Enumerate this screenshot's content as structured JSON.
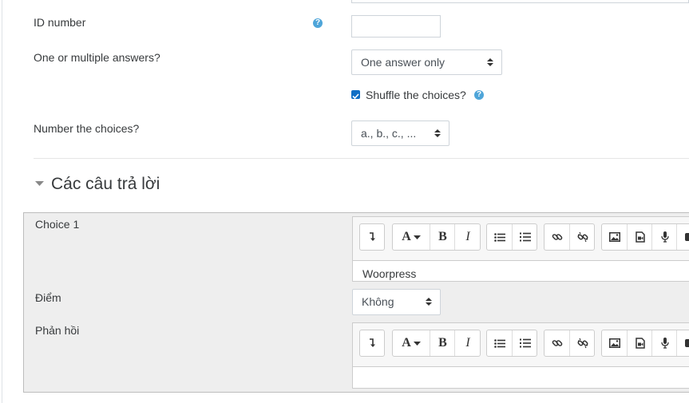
{
  "form": {
    "id_number": {
      "label": "ID number",
      "help_icon": "question-circle-icon",
      "value": ""
    },
    "answers": {
      "label": "One or multiple answers?",
      "selected": "One answer only"
    },
    "shuffle": {
      "label": "Shuffle the choices?",
      "checked": true,
      "help_icon": "question-circle-icon"
    },
    "numbering": {
      "label": "Number the choices?",
      "selected": "a., b., c., ..."
    }
  },
  "section": {
    "title": "Các câu trả lời",
    "toggle_icon": "caret-down-icon"
  },
  "choice": {
    "label": "Choice 1",
    "editor_text": "Woorpress",
    "grade": {
      "label": "Điểm",
      "selected": "Không"
    },
    "feedback": {
      "label": "Phản hồi",
      "editor_text": ""
    }
  },
  "toolbar": {
    "buttons": [
      "toggle-icon",
      "font-style-icon",
      "bold-icon",
      "italic-icon",
      "bullet-list-icon",
      "numbered-list-icon",
      "link-icon",
      "unlink-icon",
      "image-icon",
      "media-icon",
      "microphone-icon",
      "video-icon"
    ],
    "bold_glyph": "B",
    "italic_glyph": "I",
    "font_glyph": "A"
  },
  "colors": {
    "accent": "#0f6fc5",
    "help": "#4ea5d9",
    "panel_bg": "#eeeeee"
  }
}
